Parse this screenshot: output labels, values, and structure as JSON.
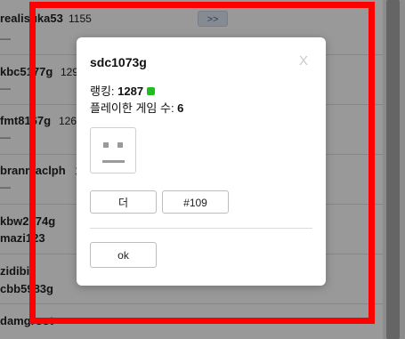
{
  "list": {
    "next_button": ">>",
    "rows": [
      {
        "name": "realisuka53",
        "rating": "1155",
        "dash": "—"
      },
      {
        "name": "kbc5177g",
        "rating": "129",
        "dash": "—"
      },
      {
        "name": "fmt8167g",
        "rating": "126",
        "dash": "—"
      },
      {
        "name": "branmaclph",
        "rating": "1",
        "dash": "—"
      },
      {
        "name": "kbw2174g",
        "name2": "mazi123"
      },
      {
        "name": "zidibi",
        "name2": "cbb5983g"
      },
      {
        "name": "damgroot"
      }
    ]
  },
  "modal": {
    "title": "sdc1073g",
    "close_label": "X",
    "rank_label": "랭킹: ",
    "rank_value": "1287",
    "status_color": "#22bb22",
    "games_label": "플레이한 게임 수: ",
    "games_value": "6",
    "avatar_icon": "robot-face-icon",
    "more_label": "더",
    "number_label": "#109",
    "ok_label": "ok"
  },
  "highlight_color": "#ff0000"
}
